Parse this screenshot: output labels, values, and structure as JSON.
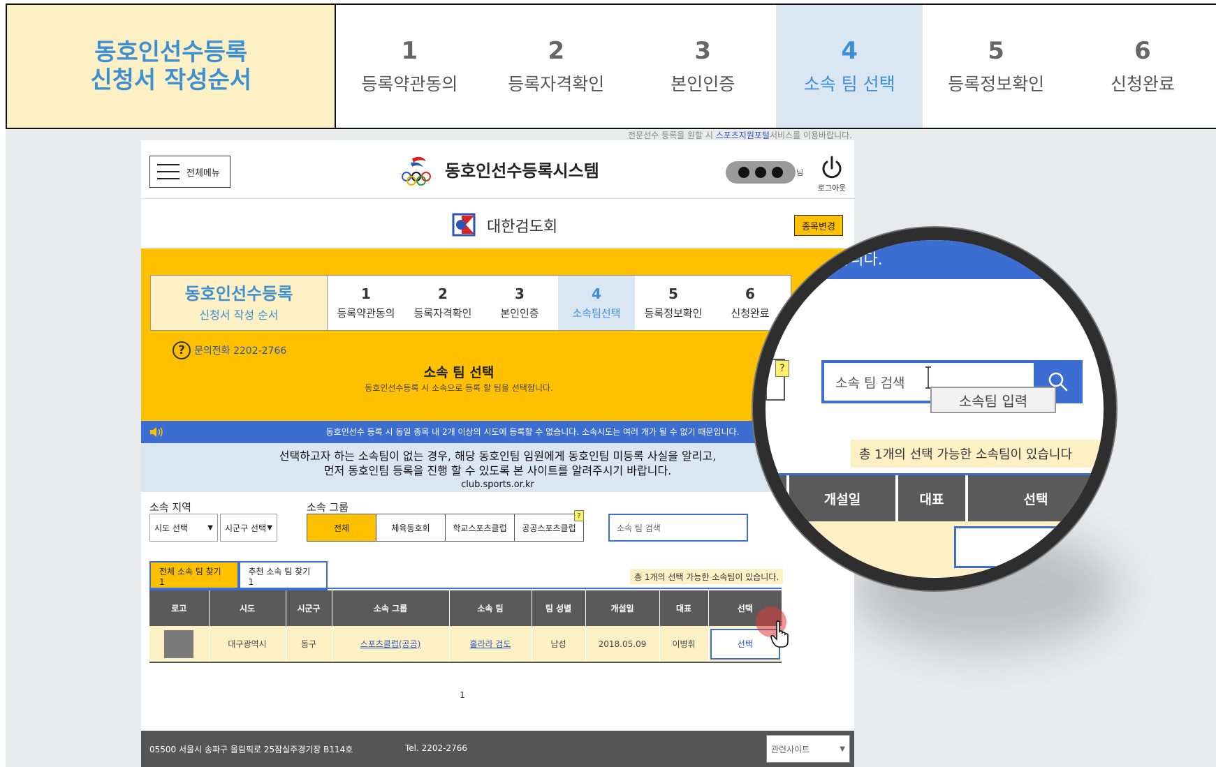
{
  "outer_header": {
    "title_line1": "동호인선수등록",
    "title_line2": "신청서 작성순서",
    "steps": [
      {
        "num": "1",
        "label": "등록약관동의"
      },
      {
        "num": "2",
        "label": "등록자격확인"
      },
      {
        "num": "3",
        "label": "본인인증"
      },
      {
        "num": "4",
        "label": "소속 팀 선택"
      },
      {
        "num": "5",
        "label": "등록정보확인"
      },
      {
        "num": "6",
        "label": "신청완료"
      }
    ],
    "active_step": 4
  },
  "top_notice": {
    "prefix": "전문선수 등록을 원할 시 ",
    "link": "스포츠지원포털",
    "suffix": "서비스를 이용바랍니다."
  },
  "site_header": {
    "menu_label": "전체메뉴",
    "site_title": "동호인선수등록시스템",
    "user_suffix": "님",
    "logout_label": "로그아웃",
    "org_name": "대한검도회",
    "change_sport_label": "종목변경"
  },
  "inner_steps": {
    "title_line1": "동호인선수등록",
    "title_line2": "신청서 작성 순서",
    "steps": [
      {
        "num": "1",
        "label": "등록약관동의"
      },
      {
        "num": "2",
        "label": "등록자격확인"
      },
      {
        "num": "3",
        "label": "본인인증"
      },
      {
        "num": "4",
        "label": "소속팀선택"
      },
      {
        "num": "5",
        "label": "등록정보확인"
      },
      {
        "num": "6",
        "label": "신청완료"
      }
    ]
  },
  "help": {
    "icon": "?",
    "text": "문의전화 2202-2766"
  },
  "section": {
    "title": "소속 팀 선택",
    "subtitle": "동호인선수등록 시 소속으로 등록 할 팀을 선택합니다."
  },
  "blue_notice": "동호인선수 등록 시 동일 종목 내 2개 이상의 시도에 등록할 수 없습니다. 소속시도는 여러 개가 될 수 없기 때문입니다.",
  "info_box": {
    "line1": "선택하고자 하는 소속팀이 없는 경우, 해당 동호인팀 임원에게 동호인팀 미등록 사실을 알리고,",
    "line2": "먼저 동호인팀 등록을 진행 할 수 있도록 본 사이트를 알려주시기 바랍니다.",
    "url": "club.sports.or.kr"
  },
  "filters": {
    "region_label": "소속 지역",
    "sido_select": "시도 선택",
    "sigungu_select": "시군구 선택",
    "group_label": "소속 그룹",
    "group_buttons": [
      "전체",
      "체육동호회",
      "학교스포츠클럽",
      "공공스포츠클럽"
    ],
    "group_q": "?",
    "search_placeholder": "소속 팀 검색"
  },
  "find_tabs": {
    "all": "전체 소속 팀 찾기 1",
    "recommended": "추천 소속 팀 찾기 1"
  },
  "count_note": "총 1개의 선택 가능한 소속팀이 있습니다.",
  "table": {
    "headers": [
      "로고",
      "시도",
      "시군구",
      "소속 그룹",
      "소속 팀",
      "팀 성별",
      "개설일",
      "대표",
      "선택"
    ],
    "rows": [
      {
        "sido": "대구광역시",
        "sigungu": "동구",
        "group": "스포츠클럽(공공)",
        "team": "홀라라 검도",
        "gender": "남성",
        "opened": "2018.05.09",
        "rep": "이병휘",
        "select": "선택"
      }
    ]
  },
  "pager": "1",
  "footer": {
    "address": "05500 서울시 송파구 올림픽로 25잠실주경기장 B114호",
    "tel": "Tel. 2202-2766",
    "related": "관련사이트"
  },
  "magnifier": {
    "top_text": "합니다.",
    "search_placeholder": "소속 팀 검색",
    "tooltip": "소속팀 입력",
    "count_text": "총 1개의 선택 가능한 소속팀이 있습니다",
    "headers": [
      "개설일",
      "대표",
      "선택"
    ],
    "q": "?"
  },
  "colors": {
    "accent_blue": "#3c6ed1",
    "yellow": "#ffc000",
    "cream": "#fdf0c4",
    "light_blue": "#dbe6f3"
  }
}
